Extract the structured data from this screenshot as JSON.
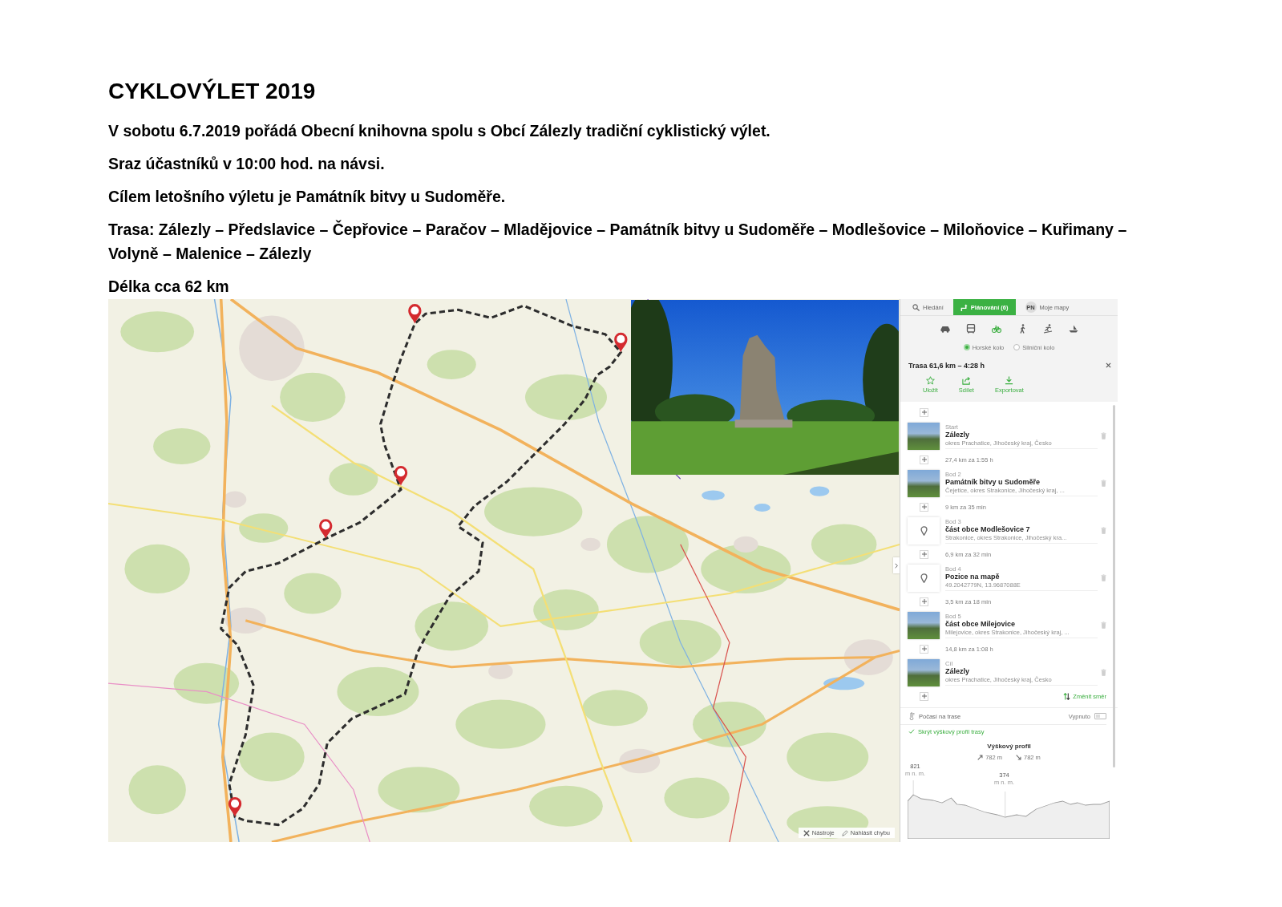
{
  "document": {
    "title": "CYKLOVÝLET 2019",
    "paragraphs": [
      "V sobotu 6.7.2019 pořádá Obecní knihovna spolu s Obcí Zálezly tradiční cyklistický výlet.",
      "Sraz účastníků v 10:00 hod. na návsi.",
      "Cílem letošního výletu je Památník bitvy u Sudoměře.",
      "Trasa: Zálezly – Předslavice – Čepřovice – Paračov – Mladějovice – Památník bitvy u Sudoměře – Modlešovice – Miloňovice – Kuřimany – Volyně – Malenice – Zálezly",
      "Délka cca 62 km"
    ]
  },
  "map_screenshot": {
    "map_tools": [
      {
        "kind": "tools",
        "label": "Nástroje"
      },
      {
        "kind": "report",
        "label": "Nahlásit chybu"
      }
    ],
    "planner": {
      "tabs": [
        {
          "kind": "search",
          "label": "Hledání",
          "selected": false
        },
        {
          "kind": "planner",
          "label": "Plánování (6)",
          "selected": true
        },
        {
          "kind": "account",
          "avatar": "PN",
          "label": "Moje mapy",
          "selected": false
        }
      ],
      "transport_modes": [
        {
          "kind": "car",
          "selected": false
        },
        {
          "kind": "transit",
          "selected": false
        },
        {
          "kind": "bike",
          "selected": true
        },
        {
          "kind": "hike",
          "selected": false
        },
        {
          "kind": "ski",
          "selected": false
        },
        {
          "kind": "boat",
          "selected": false
        }
      ],
      "bike_types": [
        {
          "label": "Horské kolo",
          "selected": true
        },
        {
          "label": "Silniční kolo",
          "selected": false
        }
      ],
      "route_title": "Trasa 61,6 km – 4:28 h",
      "actions": [
        {
          "kind": "save",
          "label": "Uložit"
        },
        {
          "kind": "share",
          "label": "Sdílet"
        },
        {
          "kind": "export",
          "label": "Exportovat"
        }
      ],
      "stops": [
        {
          "kind": "photo",
          "caption": "Start",
          "name": "Zálezly",
          "detail": "okres Prachatice, Jihočeský kraj, Česko",
          "leg": "27,4 km za 1:55 h"
        },
        {
          "kind": "photo",
          "caption": "Bod 2",
          "name": "Památník bitvy u Sudoměře",
          "detail": "Čejetice, okres Strakonice, Jihočeský kraj, ...",
          "leg": "9 km za 35 min"
        },
        {
          "kind": "pin",
          "caption": "Bod 3",
          "name": "část obce Modlešovice 7",
          "detail": "Strakonice, okres Strakonice, Jihočeský kra...",
          "leg": "6,9 km za 32 min"
        },
        {
          "kind": "pin",
          "caption": "Bod 4",
          "name": "Pozice na mapě",
          "detail": "49.2042779N, 13.9687088E",
          "leg": "3,5 km za 18 min"
        },
        {
          "kind": "photo",
          "caption": "Bod 5",
          "name": "část obce Milejovice",
          "detail": "Milejovice, okres Strakonice, Jihočeský kraj, ...",
          "leg": "14,8 km za 1:08 h"
        },
        {
          "kind": "photo",
          "caption": "Cíl",
          "name": "Zálezly",
          "detail": "okres Prachatice, Jihočeský kraj, Česko"
        }
      ],
      "reverse_label": "Změnit směr",
      "weather": {
        "label": "Počasí na trase",
        "state": "Vypnuto",
        "on": false
      },
      "profile_toggle": "Skrýt výškový profil trasy",
      "profile": {
        "title": "Výškový profil",
        "ascent": "782 m",
        "descent": "782 m",
        "max": {
          "value": "821",
          "unit": "m n. m."
        },
        "min": {
          "value": "374",
          "unit": "m n. m."
        }
      }
    }
  }
}
